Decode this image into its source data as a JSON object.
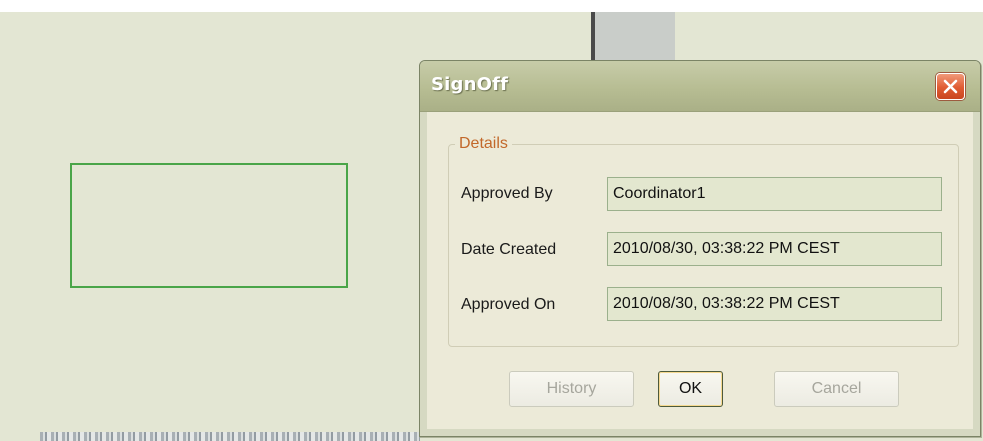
{
  "dialog": {
    "title": "SignOff",
    "group_title": "Details",
    "fields": [
      {
        "label": "Approved By",
        "value": "Coordinator1"
      },
      {
        "label": "Date Created",
        "value": "2010/08/30, 03:38:22 PM CEST"
      },
      {
        "label": "Approved On",
        "value": "2010/08/30, 03:38:22 PM CEST"
      }
    ],
    "buttons": {
      "history": "History",
      "ok": "OK",
      "cancel": "Cancel"
    }
  },
  "colors": {
    "title_bar": "#b7bd93",
    "close_button": "#e05b32",
    "legend_text": "#c2682a",
    "field_bg": "#e3e7cf"
  },
  "icons": {
    "close": "close-icon"
  }
}
